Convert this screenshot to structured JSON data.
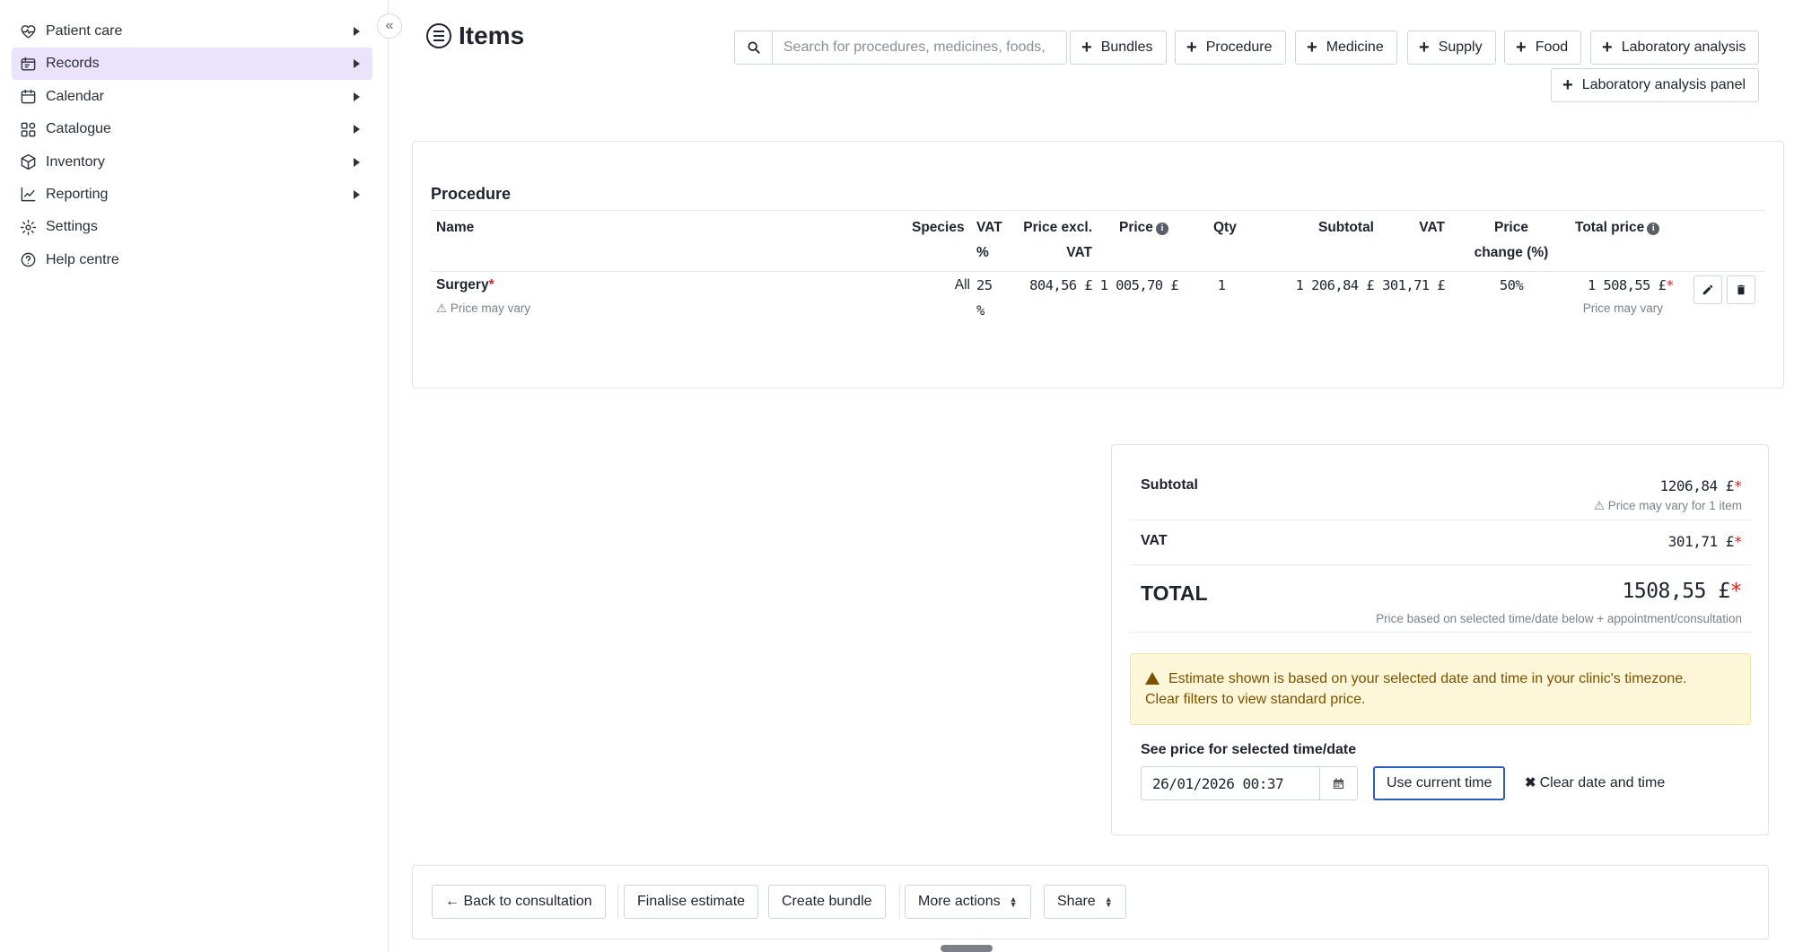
{
  "sidebar": {
    "items": [
      {
        "label": "Patient care",
        "icon": "heart-pulse-icon"
      },
      {
        "label": "Records",
        "icon": "records-icon"
      },
      {
        "label": "Calendar",
        "icon": "calendar-icon"
      },
      {
        "label": "Catalogue",
        "icon": "catalogue-icon"
      },
      {
        "label": "Inventory",
        "icon": "box-icon"
      },
      {
        "label": "Reporting",
        "icon": "chart-icon"
      },
      {
        "label": "Settings",
        "icon": "gear-icon"
      },
      {
        "label": "Help centre",
        "icon": "help-icon"
      }
    ],
    "active_index": 1,
    "collapse_icon": "double-chevron-left-icon"
  },
  "header": {
    "title": "Items",
    "search_placeholder": "Search for procedures, medicines, foods,",
    "add_buttons": [
      "Bundles",
      "Procedure",
      "Medicine",
      "Supply",
      "Food",
      "Laboratory analysis",
      "Laboratory analysis panel"
    ]
  },
  "procedure_table": {
    "heading": "Procedure",
    "columns": {
      "name": "Name",
      "species": "Species",
      "vat_pct_1": "VAT",
      "vat_pct_2": "%",
      "price_excl_1": "Price excl.",
      "price_excl_2": "VAT",
      "price": "Price",
      "qty": "Qty",
      "subtotal": "Subtotal",
      "vat": "VAT",
      "price_change_1": "Price",
      "price_change_2": "change (%)",
      "total_price": "Total price"
    },
    "rows": [
      {
        "name": "Surgery",
        "name_note": "⚠ Price may vary",
        "species": "All",
        "vat_pct_1": "25",
        "vat_pct_2": "%",
        "price_excl_vat": "804,56 £",
        "price": "1 005,70 £",
        "qty": "1",
        "subtotal": "1 206,84 £",
        "vat": "301,71 £",
        "price_change": "50%",
        "total_price": "1 508,55 £",
        "total_note": "Price may vary"
      }
    ]
  },
  "totals": {
    "subtotal_label": "Subtotal",
    "subtotal_value": "1206,84 £",
    "subtotal_note": "⚠ Price may vary for 1 item",
    "vat_label": "VAT",
    "vat_value": "301,71 £",
    "total_label": "TOTAL",
    "total_value": "1508,55 £",
    "total_note": "Price based on selected time/date below + appointment/consultation",
    "alert_line1": "Estimate shown is based on your selected date and time in your clinic's timezone.",
    "alert_line2": "Clear filters to view standard price.",
    "datetime_label": "See price for selected time/date",
    "datetime_value": "26/01/2026 00:37",
    "use_current_time": "Use current time",
    "clear_date_time": "Clear date and time"
  },
  "footer": {
    "back": "← Back to consultation",
    "finalise": "Finalise estimate",
    "create_bundle": "Create bundle",
    "more_actions": "More actions",
    "share": "Share"
  },
  "colors": {
    "active_nav_bg": "#ebe3fb",
    "required_star": "#dd2222",
    "alert_bg": "#fdf6d8",
    "alert_text": "#7a5200",
    "focus_border": "#2c5db8"
  }
}
